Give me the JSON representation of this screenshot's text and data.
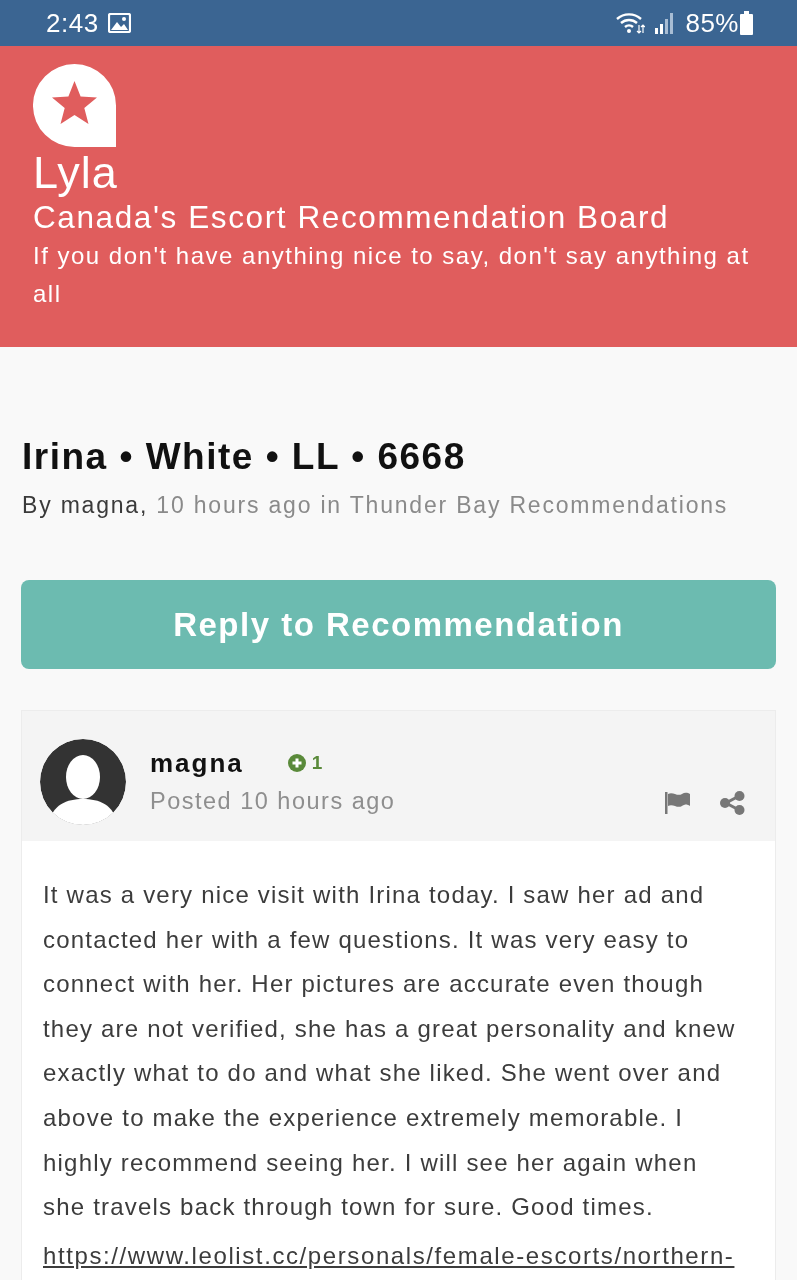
{
  "status_bar": {
    "time": "2:43",
    "battery": "85%"
  },
  "header": {
    "site_name": "Lyla",
    "subtitle": "Canada's Escort Recommendation Board",
    "tagline": "If you don't have anything nice to say, don't say anything at all"
  },
  "topic": {
    "title": "Irina • White • LL • 6668",
    "byline": "By magna,",
    "meta": "10 hours ago in Thunder Bay Recommendations"
  },
  "reply_button": "Reply to Recommendation",
  "post": {
    "author": "magna",
    "reputation": "1",
    "posted": "Posted 10 hours ago",
    "body": "It was a very nice visit with Irina today. I saw her ad and contacted her with a few questions. It was very easy to connect with her. Her pictures are accurate even though they are not verified, she has a great personality and knew exactly what to do and what she liked. She went over and above to make the experience extremely memorable. I highly recommend seeing her. I will see her again when she travels back through town for sure. Good times.",
    "link": "https://www.leolist.cc/personals/female-escorts/northern-"
  }
}
